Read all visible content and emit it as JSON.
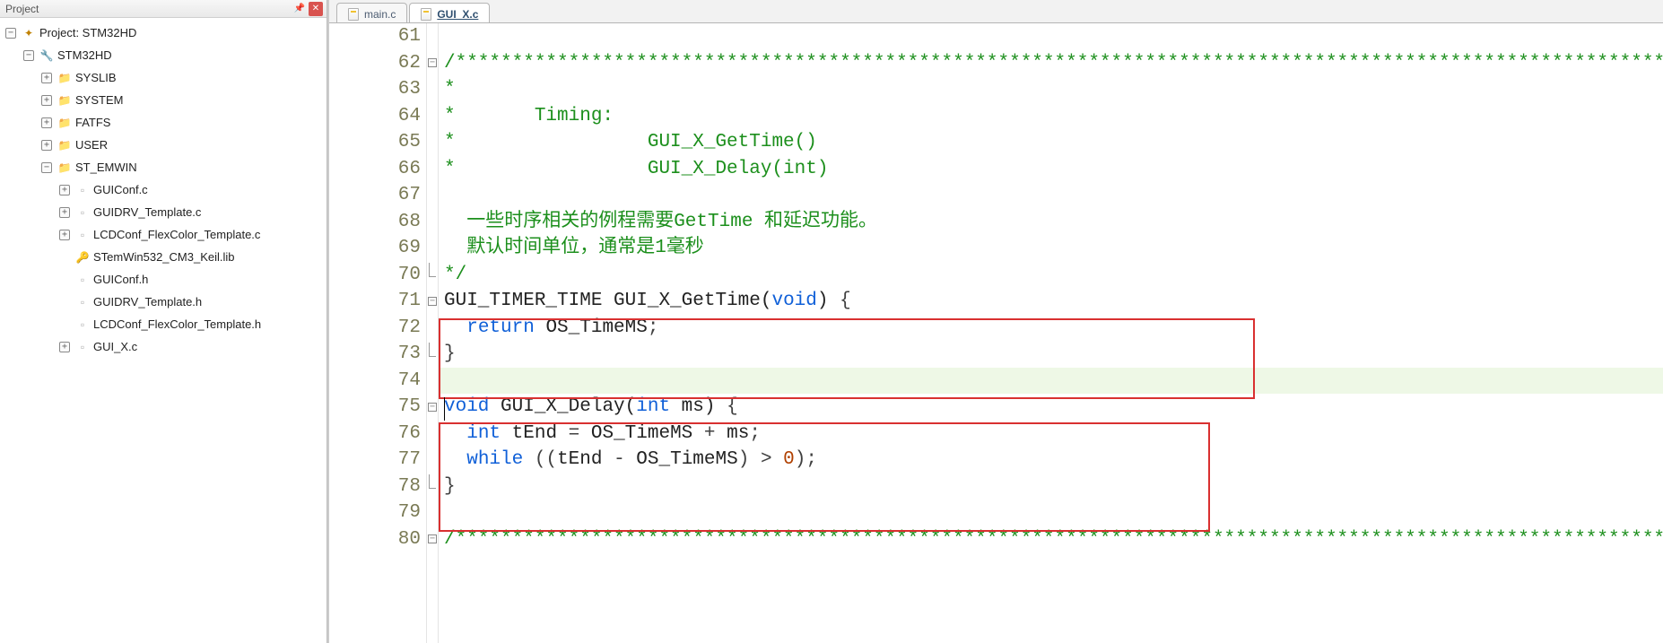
{
  "panel": {
    "title": "Project"
  },
  "project": {
    "root_label": "Project: STM32HD",
    "target_label": "STM32HD",
    "groups": [
      {
        "label": "SYSLIB",
        "expanded": false
      },
      {
        "label": "SYSTEM",
        "expanded": false
      },
      {
        "label": "FATFS",
        "expanded": false
      },
      {
        "label": "USER",
        "expanded": false
      },
      {
        "label": "ST_EMWIN",
        "expanded": true,
        "children": [
          {
            "label": "GUIConf.c",
            "kind": "c",
            "expandable": true
          },
          {
            "label": "GUIDRV_Template.c",
            "kind": "c",
            "expandable": true
          },
          {
            "label": "LCDConf_FlexColor_Template.c",
            "kind": "c",
            "expandable": true
          },
          {
            "label": "STemWin532_CM3_Keil.lib",
            "kind": "lib",
            "expandable": false
          },
          {
            "label": "GUIConf.h",
            "kind": "h",
            "expandable": false
          },
          {
            "label": "GUIDRV_Template.h",
            "kind": "h",
            "expandable": false
          },
          {
            "label": "LCDConf_FlexColor_Template.h",
            "kind": "h",
            "expandable": false
          },
          {
            "label": "GUI_X.c",
            "kind": "c",
            "expandable": true
          }
        ]
      }
    ]
  },
  "tabs": [
    {
      "label": "main.c",
      "active": false
    },
    {
      "label": "GUI_X.c",
      "active": true
    }
  ],
  "icons": {
    "pin": "⏷",
    "close": "✕",
    "plus": "+",
    "minus": "−"
  },
  "code": {
    "first_line_no": 61,
    "cursor_line": 74,
    "highlight_blocks": [
      [
        71,
        73
      ],
      [
        75,
        78
      ]
    ],
    "lines": [
      {
        "n": 61,
        "fold": "",
        "spans": []
      },
      {
        "n": 62,
        "fold": "minus",
        "spans": [
          [
            "comment",
            "/*********************************************************************************************************************"
          ]
        ]
      },
      {
        "n": 63,
        "fold": "",
        "spans": [
          [
            "comment",
            "*"
          ]
        ]
      },
      {
        "n": 64,
        "fold": "",
        "spans": [
          [
            "comment",
            "*       Timing:"
          ]
        ]
      },
      {
        "n": 65,
        "fold": "",
        "spans": [
          [
            "comment",
            "*                 GUI_X_GetTime()"
          ]
        ]
      },
      {
        "n": 66,
        "fold": "",
        "spans": [
          [
            "comment",
            "*                 GUI_X_Delay(int)"
          ]
        ]
      },
      {
        "n": 67,
        "fold": "",
        "spans": []
      },
      {
        "n": 68,
        "fold": "",
        "spans": [
          [
            "comment",
            "  一些时序相关的例程需要GetTime 和延迟功能。"
          ]
        ]
      },
      {
        "n": 69,
        "fold": "",
        "spans": [
          [
            "comment",
            "  默认时间单位，通常是1毫秒"
          ]
        ]
      },
      {
        "n": 70,
        "fold": "end",
        "spans": [
          [
            "comment",
            "*/"
          ]
        ]
      },
      {
        "n": 71,
        "fold": "minus",
        "spans": [
          [
            "ident",
            "GUI_TIMER_TIME GUI_X_GetTime("
          ],
          [
            "keyword",
            "void"
          ],
          [
            "ident",
            ") "
          ],
          [
            "punc",
            "{"
          ]
        ]
      },
      {
        "n": 72,
        "fold": "",
        "spans": [
          [
            "ident",
            "  "
          ],
          [
            "keyword",
            "return"
          ],
          [
            "ident",
            " OS_TimeMS"
          ],
          [
            "punc",
            ";"
          ]
        ]
      },
      {
        "n": 73,
        "fold": "end",
        "spans": [
          [
            "punc",
            "}"
          ]
        ]
      },
      {
        "n": 74,
        "fold": "",
        "spans": []
      },
      {
        "n": 75,
        "fold": "minus",
        "spans": [
          [
            "keyword",
            "void"
          ],
          [
            "ident",
            " GUI_X_Delay("
          ],
          [
            "keyword",
            "int"
          ],
          [
            "ident",
            " ms) "
          ],
          [
            "punc",
            "{"
          ]
        ]
      },
      {
        "n": 76,
        "fold": "",
        "spans": [
          [
            "ident",
            "  "
          ],
          [
            "keyword",
            "int"
          ],
          [
            "ident",
            " tEnd "
          ],
          [
            "punc",
            "="
          ],
          [
            "ident",
            " OS_TimeMS "
          ],
          [
            "punc",
            "+"
          ],
          [
            "ident",
            " ms"
          ],
          [
            "punc",
            ";"
          ]
        ]
      },
      {
        "n": 77,
        "fold": "",
        "spans": [
          [
            "ident",
            "  "
          ],
          [
            "keyword",
            "while"
          ],
          [
            "ident",
            " "
          ],
          [
            "punc",
            "(("
          ],
          [
            "ident",
            "tEnd "
          ],
          [
            "punc",
            "-"
          ],
          [
            "ident",
            " OS_TimeMS"
          ],
          [
            "punc",
            ")"
          ],
          [
            "ident",
            " "
          ],
          [
            "punc",
            ">"
          ],
          [
            "ident",
            " "
          ],
          [
            "num",
            "0"
          ],
          [
            "punc",
            ");"
          ]
        ]
      },
      {
        "n": 78,
        "fold": "end",
        "spans": [
          [
            "punc",
            "}"
          ]
        ]
      },
      {
        "n": 79,
        "fold": "",
        "spans": []
      },
      {
        "n": 80,
        "fold": "minus",
        "spans": [
          [
            "comment",
            "/*********************************************************************************************************************"
          ]
        ]
      }
    ]
  }
}
